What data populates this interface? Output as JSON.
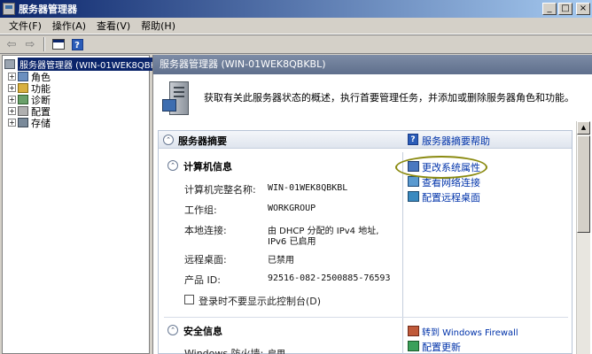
{
  "window": {
    "title": "服务器管理器"
  },
  "window_controls": {
    "minimize": "_",
    "restore": "□",
    "close": "×"
  },
  "menu": [
    "文件(F)",
    "操作(A)",
    "查看(V)",
    "帮助(H)"
  ],
  "toolbar": {
    "back": "⇦",
    "forward": "⇨",
    "help": "?"
  },
  "tree": {
    "root": "服务器管理器 (WIN-01WEK8QBKBL",
    "items": [
      {
        "label": "角色",
        "expander": "+"
      },
      {
        "label": "功能",
        "expander": "+"
      },
      {
        "label": "诊断",
        "expander": "+"
      },
      {
        "label": "配置",
        "expander": "+"
      },
      {
        "label": "存储",
        "expander": "+"
      }
    ]
  },
  "main": {
    "header": "服务器管理器 (WIN-01WEK8QBKBL)",
    "intro_text": "获取有关此服务器状态的概述，执行首要管理任务，并添加或删除服务器角色和功能。",
    "summary": {
      "title": "服务器摘要",
      "collapse_glyph": "⌃",
      "help_link": "服务器摘要帮助",
      "computer_info": {
        "title": "计算机信息",
        "fields": [
          {
            "label": "计算机完整名称:",
            "value": "WIN-01WEK8QBKBL"
          },
          {
            "label": "工作组:",
            "value": "WORKGROUP"
          },
          {
            "label": "本地连接:",
            "value_line1": "由 DHCP 分配的 IPv4 地址,",
            "value_line2": "IPv6 已启用"
          },
          {
            "label": "远程桌面:",
            "value": "已禁用"
          },
          {
            "label": "产品 ID:",
            "value": "92516-082-2500885-76593"
          }
        ],
        "checkbox_label": "登录时不要显示此控制台(D)",
        "tasks": [
          "更改系统属性",
          "查看网络连接",
          "配置远程桌面"
        ]
      },
      "security_info": {
        "title": "安全信息",
        "fields": [
          {
            "label": "Windows 防火墙:",
            "value": "启用"
          }
        ],
        "tasks": [
          "转到 Windows Firewall",
          "配置更新"
        ]
      }
    }
  }
}
